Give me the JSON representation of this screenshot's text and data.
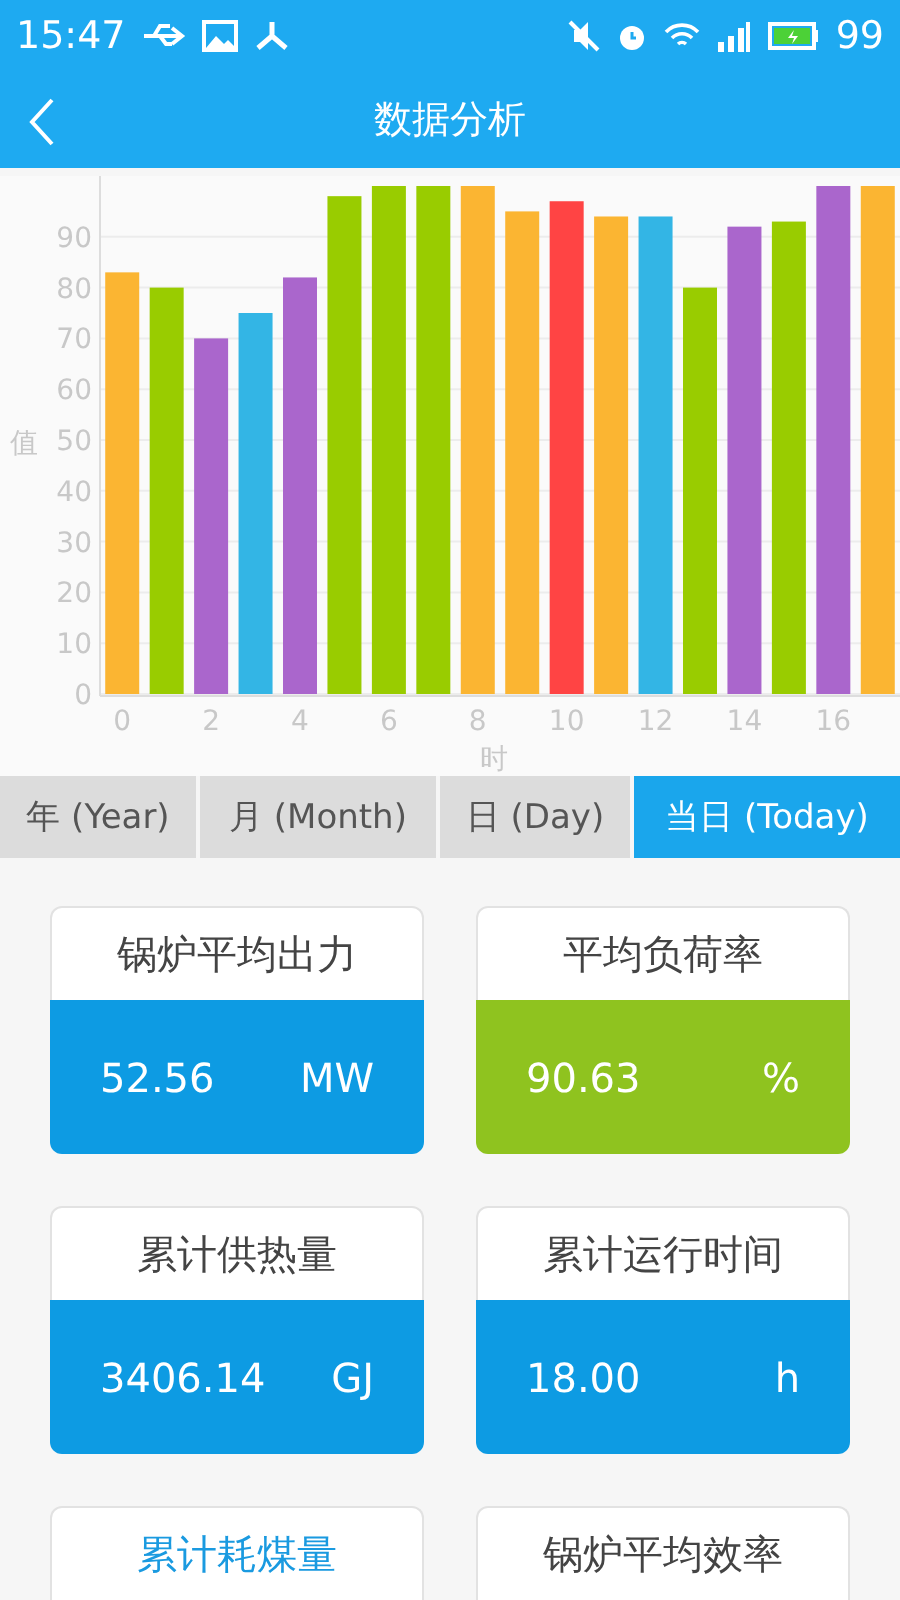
{
  "status_bar": {
    "time": "15:47",
    "battery": "99"
  },
  "header": {
    "title": "数据分析"
  },
  "chart": {
    "chart_data": {
      "type": "bar",
      "xlabel": "时",
      "ylabel": "值",
      "grid": true,
      "x": [
        0,
        1,
        2,
        3,
        4,
        5,
        6,
        7,
        8,
        9,
        10,
        11,
        12,
        13,
        14,
        15,
        16,
        17
      ],
      "series": [
        {
          "color": "#fbb532",
          "values": [
            83,
            null,
            null,
            null,
            null,
            null,
            null,
            null,
            100,
            95,
            null,
            94,
            null,
            null,
            null,
            null,
            null,
            100
          ]
        },
        {
          "color": "#99cc00",
          "values": [
            null,
            80,
            null,
            null,
            null,
            98,
            100,
            100,
            null,
            null,
            null,
            null,
            null,
            80,
            null,
            93,
            null,
            null
          ]
        },
        {
          "color": "#aa66cc",
          "values": [
            null,
            null,
            70,
            null,
            82,
            null,
            null,
            null,
            null,
            null,
            null,
            null,
            null,
            null,
            92,
            null,
            100,
            null
          ]
        },
        {
          "color": "#33b5e5",
          "values": [
            null,
            null,
            null,
            75,
            null,
            null,
            null,
            null,
            null,
            null,
            null,
            null,
            94,
            null,
            null,
            null,
            null,
            null
          ]
        },
        {
          "color": "#ff4444",
          "values": [
            null,
            null,
            null,
            null,
            null,
            null,
            null,
            null,
            null,
            null,
            97,
            null,
            null,
            null,
            null,
            null,
            null,
            null
          ]
        }
      ],
      "xlim": [
        -0.5,
        17.5
      ],
      "ylim": [
        0,
        100
      ],
      "yticks": [
        0,
        10,
        20,
        30,
        40,
        50,
        60,
        70,
        80,
        90
      ],
      "xticks": [
        0,
        2,
        4,
        6,
        8,
        10,
        12,
        14,
        16
      ]
    }
  },
  "tabs": [
    {
      "label": "年 (Year)",
      "selected": false
    },
    {
      "label": "月 (Month)",
      "selected": false
    },
    {
      "label": "日 (Day)",
      "selected": false
    },
    {
      "label": "当日 (Today)",
      "selected": true
    }
  ],
  "cards": [
    {
      "title": "锅炉平均出力",
      "value": "52.56",
      "unit": "MW",
      "color": "#0d9be3",
      "title_highlighted": false
    },
    {
      "title": "平均负荷率",
      "value": "90.63",
      "unit": "%",
      "color": "#8fc31f",
      "title_highlighted": false
    },
    {
      "title": "累计供热量",
      "value": "3406.14",
      "unit": "GJ",
      "color": "#0d9be3",
      "title_highlighted": false
    },
    {
      "title": "累计运行时间",
      "value": "18.00",
      "unit": "h",
      "color": "#0d9be3",
      "title_highlighted": false
    },
    {
      "title": "累计耗煤量",
      "title_highlighted": true
    },
    {
      "title": "锅炉平均效率",
      "title_highlighted": false
    }
  ]
}
